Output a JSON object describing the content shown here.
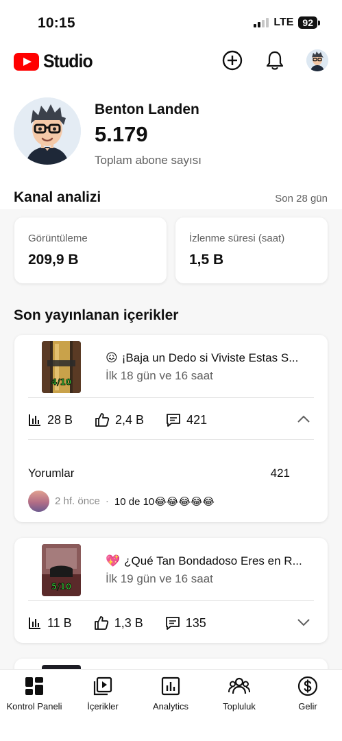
{
  "status_bar": {
    "time": "10:15",
    "network": "LTE",
    "battery": "92"
  },
  "header": {
    "app_name": "Studio"
  },
  "profile": {
    "name": "Benton Landen",
    "subscribers": "5.179",
    "subscribers_label": "Toplam abone sayısı"
  },
  "analytics": {
    "title": "Kanal analizi",
    "period": "Son 28 gün",
    "cards": [
      {
        "label": "Görüntüleme",
        "value": "209,9 B"
      },
      {
        "label": "İzlenme süresi (saat)",
        "value": "1,5 B"
      }
    ]
  },
  "recent": {
    "title": "Son yayınlanan içerikler",
    "videos": [
      {
        "emoji": "😖",
        "title": "¡Baja un Dedo si Viviste Estas S...",
        "age": "İlk 18 gün ve 16 saat",
        "views": "28 B",
        "likes": "2,4 B",
        "comments": "421",
        "thumb_badge": "4/10",
        "expanded": true,
        "comments_section": {
          "label": "Yorumlar",
          "count": "421",
          "latest_time": "2 hf. önce",
          "latest_text": "10 de 10😂😂😂😂😂"
        }
      },
      {
        "emoji": "💖",
        "title": "¿Qué Tan Bondadoso Eres en R...",
        "age": "İlk 19 gün ve 16 saat",
        "views": "11 B",
        "likes": "1,3 B",
        "comments": "135",
        "thumb_badge": "5/10",
        "expanded": false
      }
    ]
  },
  "bottom_nav": [
    {
      "label": "Kontrol Paneli",
      "icon": "dashboard-icon"
    },
    {
      "label": "İçerikler",
      "icon": "content-icon"
    },
    {
      "label": "Analytics",
      "icon": "analytics-icon"
    },
    {
      "label": "Topluluk",
      "icon": "community-icon"
    },
    {
      "label": "Gelir",
      "icon": "earn-icon"
    }
  ],
  "colors": {
    "brand": "#ff0000",
    "text": "#0f0f0f",
    "secondary": "#606060",
    "background": "#f7f7f7"
  }
}
